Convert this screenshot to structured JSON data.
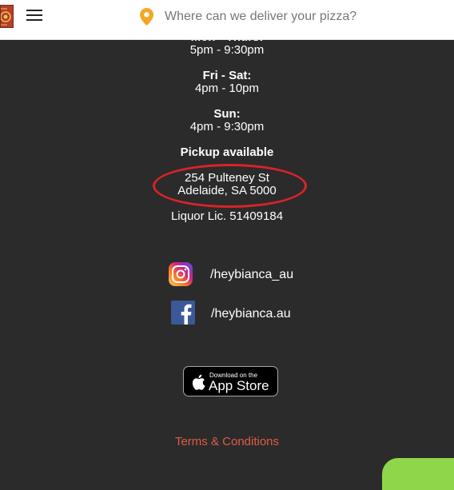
{
  "header": {
    "search_placeholder": "Where can we deliver your pizza?",
    "colors": {
      "pin": "#f5a623",
      "logo": "#b3402a"
    }
  },
  "hours": {
    "mon_thu_label": "Mon - Thurs:",
    "mon_thu_time": "5pm - 9:30pm",
    "fri_sat_label": "Fri - Sat:",
    "fri_sat_time": "4pm - 10pm",
    "sun_label": "Sun:",
    "sun_time": "4pm - 9:30pm"
  },
  "pickup": "Pickup available",
  "address": {
    "line1": "254 Pulteney St",
    "line2": "Adelaide, SA 5000"
  },
  "liquor": "Liquor Lic. 51409184",
  "social": {
    "instagram": {
      "label": "/heybianca_au",
      "icon": "instagram-icon"
    },
    "facebook": {
      "label": "/heybianca.au",
      "icon": "facebook-icon"
    }
  },
  "appstore": {
    "small": "Download on the",
    "big": "App Store"
  },
  "terms": "Terms & Conditions",
  "colors": {
    "background": "#2b2b2b",
    "terms": "#e25b45",
    "highlight_ring": "#d8232a",
    "chat": "#8fd64a"
  }
}
